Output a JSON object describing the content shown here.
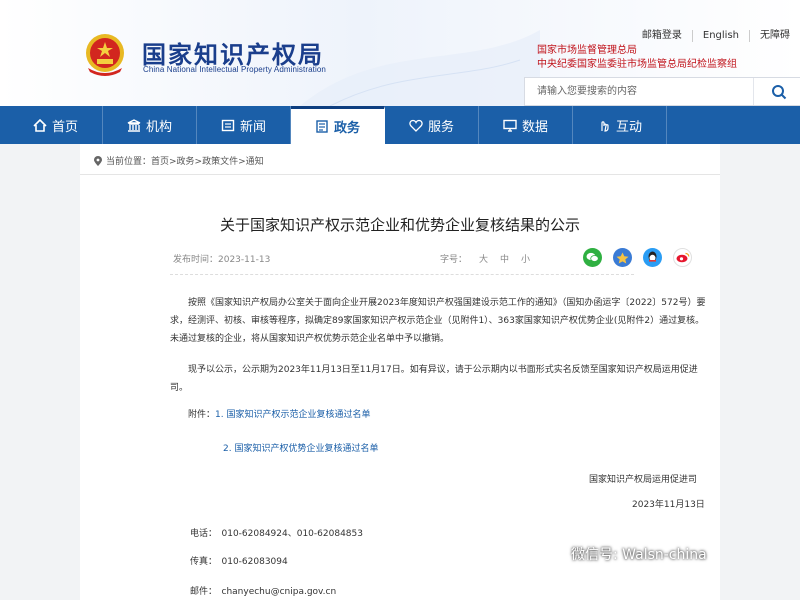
{
  "header": {
    "logo_cn": "国家知识产权局",
    "logo_en": "China National Intellectual Property Administration",
    "top_links": [
      "邮箱登录",
      "English",
      "无障碍"
    ],
    "supervise_line1": "国家市场监督管理总局",
    "supervise_line2": "中央纪委国家监委驻市场监管总局纪检监察组",
    "search_placeholder": "请输入您要搜索的内容"
  },
  "nav": {
    "items": [
      {
        "label": "首页",
        "icon": "home-icon"
      },
      {
        "label": "机构",
        "icon": "building-icon"
      },
      {
        "label": "新闻",
        "icon": "news-icon"
      },
      {
        "label": "政务",
        "icon": "document-icon",
        "active": true
      },
      {
        "label": "服务",
        "icon": "heart-icon"
      },
      {
        "label": "数据",
        "icon": "screen-icon"
      },
      {
        "label": "互动",
        "icon": "hand-icon"
      }
    ]
  },
  "breadcrumb": "当前位置：首页>政务>政策文件>通知",
  "article": {
    "title": "关于国家知识产权示范企业和优势企业复核结果的公示",
    "publish_time": "发布时间：2023-11-13",
    "font_size_label": "字号：",
    "font_sizes": [
      "大",
      "中",
      "小"
    ],
    "paragraph1": "按照《国家知识产权局办公室关于面向企业开展2023年度知识产权强国建设示范工作的通知》（国知办函运字〔2022〕572号）要求，经测评、初核、审核等程序，拟确定89家国家知识产权示范企业（见附件1）、363家国家知识产权优势企业(见附件2）通过复核。未通过复核的企业，将从国家知识产权优势示范企业名单中予以撤销。",
    "paragraph2": "现予以公示，公示期为2023年11月13日至11月17日。如有异议，请于公示期内以书面形式实名反馈至国家知识产权局运用促进司。",
    "attach_label": "附件：",
    "attach1": "1. 国家知识产权示范企业复核通过名单",
    "attach2": "2. 国家知识产权优势企业复核通过名单",
    "signature": "国家知识产权局运用促进司",
    "date": "2023年11月13日",
    "phone": "电话：　010-62084924、010-62084853",
    "fax": "传真：　010-62083094",
    "email": "邮件：　chanyechu@cnipa.gov.cn"
  },
  "watermark": "微信号: Walsn-china",
  "colors": {
    "nav_blue": "#1b5fa8",
    "logo_blue": "#1a3e8c",
    "red": "#c0121a"
  }
}
